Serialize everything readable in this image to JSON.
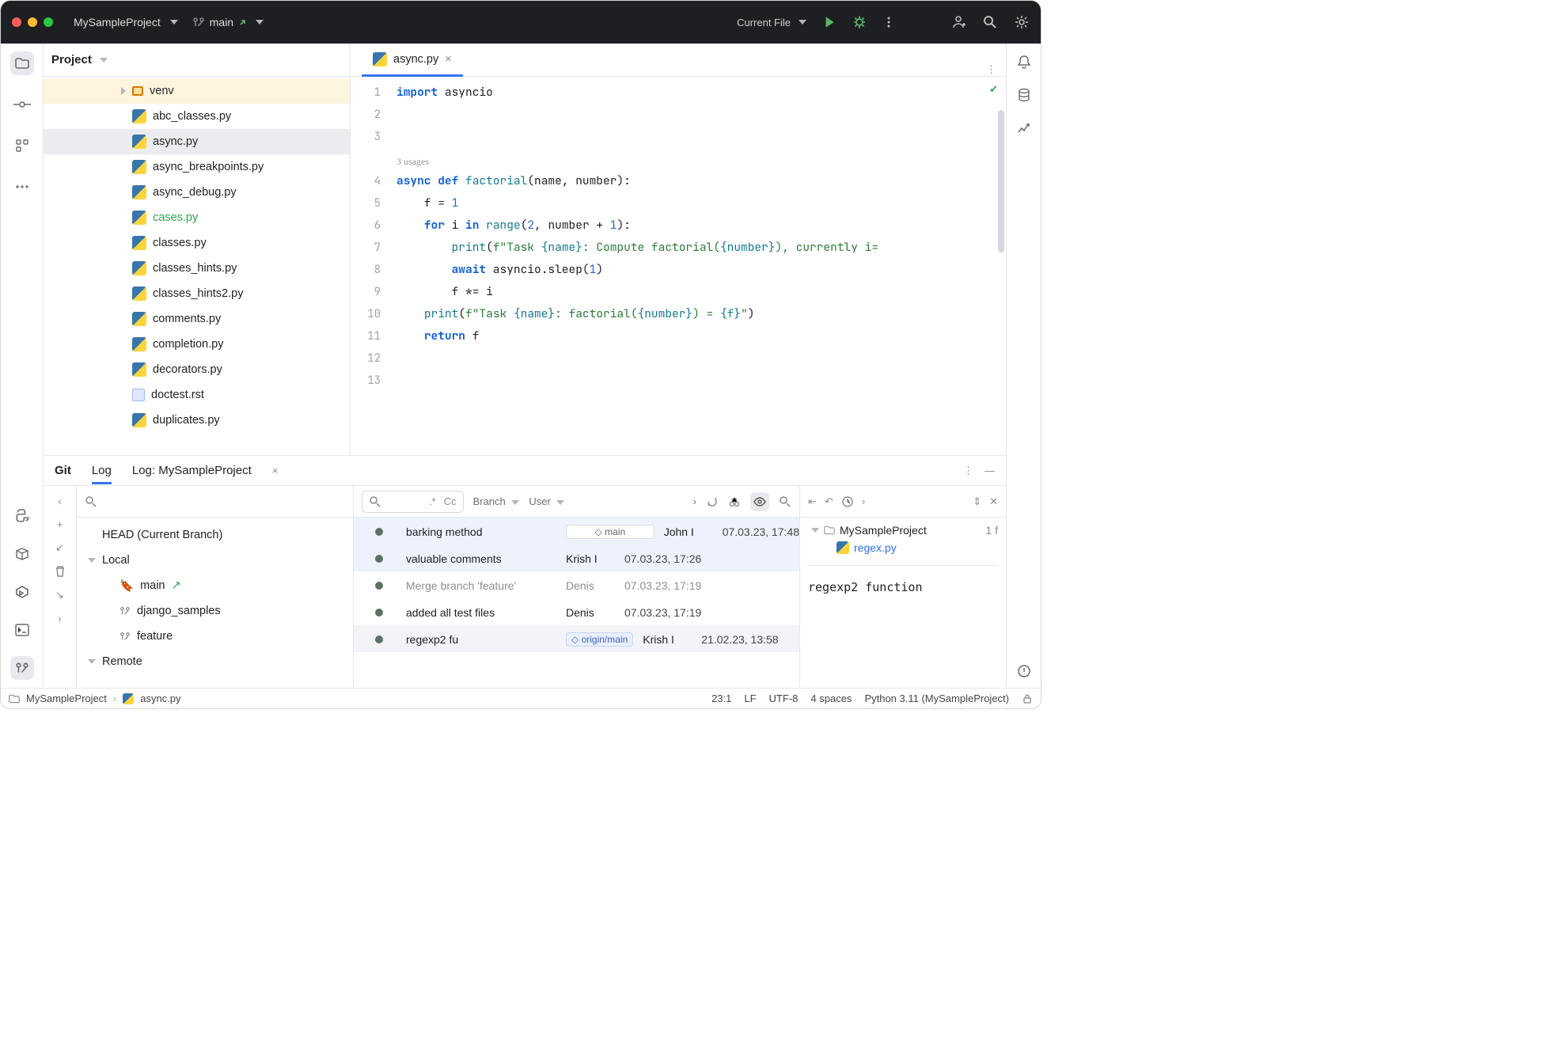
{
  "titlebar": {
    "project": "MySampleProject",
    "branch": "main",
    "run_config": "Current File"
  },
  "project_panel": {
    "title": "Project",
    "items": [
      {
        "type": "folder",
        "name": "venv",
        "hl": true,
        "twisty": true
      },
      {
        "type": "py",
        "name": "abc_classes.py"
      },
      {
        "type": "py",
        "name": "async.py",
        "selected": true
      },
      {
        "type": "py",
        "name": "async_breakpoints.py"
      },
      {
        "type": "py",
        "name": "async_debug.py"
      },
      {
        "type": "py",
        "name": "cases.py",
        "green": true
      },
      {
        "type": "py",
        "name": "classes.py"
      },
      {
        "type": "py",
        "name": "classes_hints.py"
      },
      {
        "type": "py",
        "name": "classes_hints2.py"
      },
      {
        "type": "py",
        "name": "comments.py"
      },
      {
        "type": "py",
        "name": "completion.py"
      },
      {
        "type": "py",
        "name": "decorators.py"
      },
      {
        "type": "rst",
        "name": "doctest.rst"
      },
      {
        "type": "py",
        "name": "duplicates.py"
      }
    ]
  },
  "editor": {
    "tab": "async.py",
    "usages_hint": "3 usages",
    "lines": [
      "1",
      "2",
      "3",
      "",
      "4",
      "5",
      "6",
      "7",
      "8",
      "9",
      "10",
      "11",
      "12",
      "13"
    ],
    "code_tokens": [
      [
        [
          "kw",
          "import"
        ],
        [
          "",
          " asyncio"
        ]
      ],
      [
        [
          "",
          ""
        ]
      ],
      [
        [
          "",
          ""
        ]
      ],
      [
        [
          "",
          ""
        ]
      ],
      [
        [
          "def",
          "async def "
        ],
        [
          "fn",
          "factorial"
        ],
        [
          "",
          "(name, number):"
        ]
      ],
      [
        [
          "",
          "    f = "
        ],
        [
          "num",
          "1"
        ]
      ],
      [
        [
          "",
          "    "
        ],
        [
          "kw",
          "for"
        ],
        [
          "",
          " i "
        ],
        [
          "kw",
          "in"
        ],
        [
          "",
          " "
        ],
        [
          "fn",
          "range"
        ],
        [
          "",
          "("
        ],
        [
          "num",
          "2"
        ],
        [
          "",
          ", number + "
        ],
        [
          "num",
          "1"
        ],
        [
          "",
          "):"
        ]
      ],
      [
        [
          "",
          "        "
        ],
        [
          "fn",
          "print"
        ],
        [
          "",
          "("
        ],
        [
          "str",
          "f\"Task "
        ],
        [
          "fx",
          "{name}"
        ],
        [
          "str",
          ": Compute factorial("
        ],
        [
          "fx",
          "{number}"
        ],
        [
          "str",
          "), currently i="
        ]
      ],
      [
        [
          "",
          "        "
        ],
        [
          "kw",
          "await"
        ],
        [
          "",
          " asyncio.sleep("
        ],
        [
          "num",
          "1"
        ],
        [
          "",
          ")"
        ]
      ],
      [
        [
          "",
          "        f *= i"
        ]
      ],
      [
        [
          "",
          "    "
        ],
        [
          "fn",
          "print"
        ],
        [
          "",
          "("
        ],
        [
          "str",
          "f\"Task "
        ],
        [
          "fx",
          "{name}"
        ],
        [
          "str",
          ": factorial("
        ],
        [
          "fx",
          "{number}"
        ],
        [
          "str",
          ") = "
        ],
        [
          "fx",
          "{f}"
        ],
        [
          "str",
          "\""
        ],
        [
          "",
          ")"
        ]
      ],
      [
        [
          "",
          "    "
        ],
        [
          "kw",
          "return"
        ],
        [
          "",
          " f"
        ]
      ],
      [
        [
          "",
          ""
        ]
      ],
      [
        [
          "",
          ""
        ]
      ]
    ]
  },
  "git": {
    "tabs": {
      "git": "Git",
      "log": "Log",
      "log2": "Log: MySampleProject"
    },
    "filters": {
      "branch": "Branch",
      "user": "User",
      "regex": ".*",
      "case": "Cc"
    },
    "branches": {
      "head": "HEAD (Current Branch)",
      "groups": [
        {
          "name": "Local",
          "items": [
            {
              "name": "main",
              "tag": "yellow",
              "arrow": true
            },
            {
              "name": "django_samples"
            },
            {
              "name": "feature"
            }
          ]
        },
        {
          "name": "Remote",
          "items": []
        }
      ]
    },
    "commits": [
      {
        "msg": "barking method",
        "tag": "main",
        "author": "John I",
        "date": "07.03.23, 17:48",
        "sel": 1
      },
      {
        "msg": "valuable comments",
        "author": "Krish I",
        "date": "07.03.23, 17:26",
        "sel": 1
      },
      {
        "msg": "Merge branch 'feature'",
        "author": "Denis",
        "date": "07.03.23, 17:19",
        "dim": true
      },
      {
        "msg": "added all test files",
        "author": "Denis",
        "date": "07.03.23, 17:19"
      },
      {
        "msg": "regexp2 fu",
        "tag": "origin/main",
        "author": "Krish I",
        "date": "21.02.23, 13:58",
        "sel": 2
      }
    ],
    "detail": {
      "project": "MySampleProject",
      "changed": "1 f",
      "file": "regex.py",
      "title": "regexp2 function"
    }
  },
  "statusbar": {
    "breadcrumb_root": "MySampleProject",
    "breadcrumb_file": "async.py",
    "pos": "23:1",
    "enc_lf": "LF",
    "enc": "UTF-8",
    "indent": "4 spaces",
    "interp": "Python 3.11 (MySampleProject)"
  }
}
